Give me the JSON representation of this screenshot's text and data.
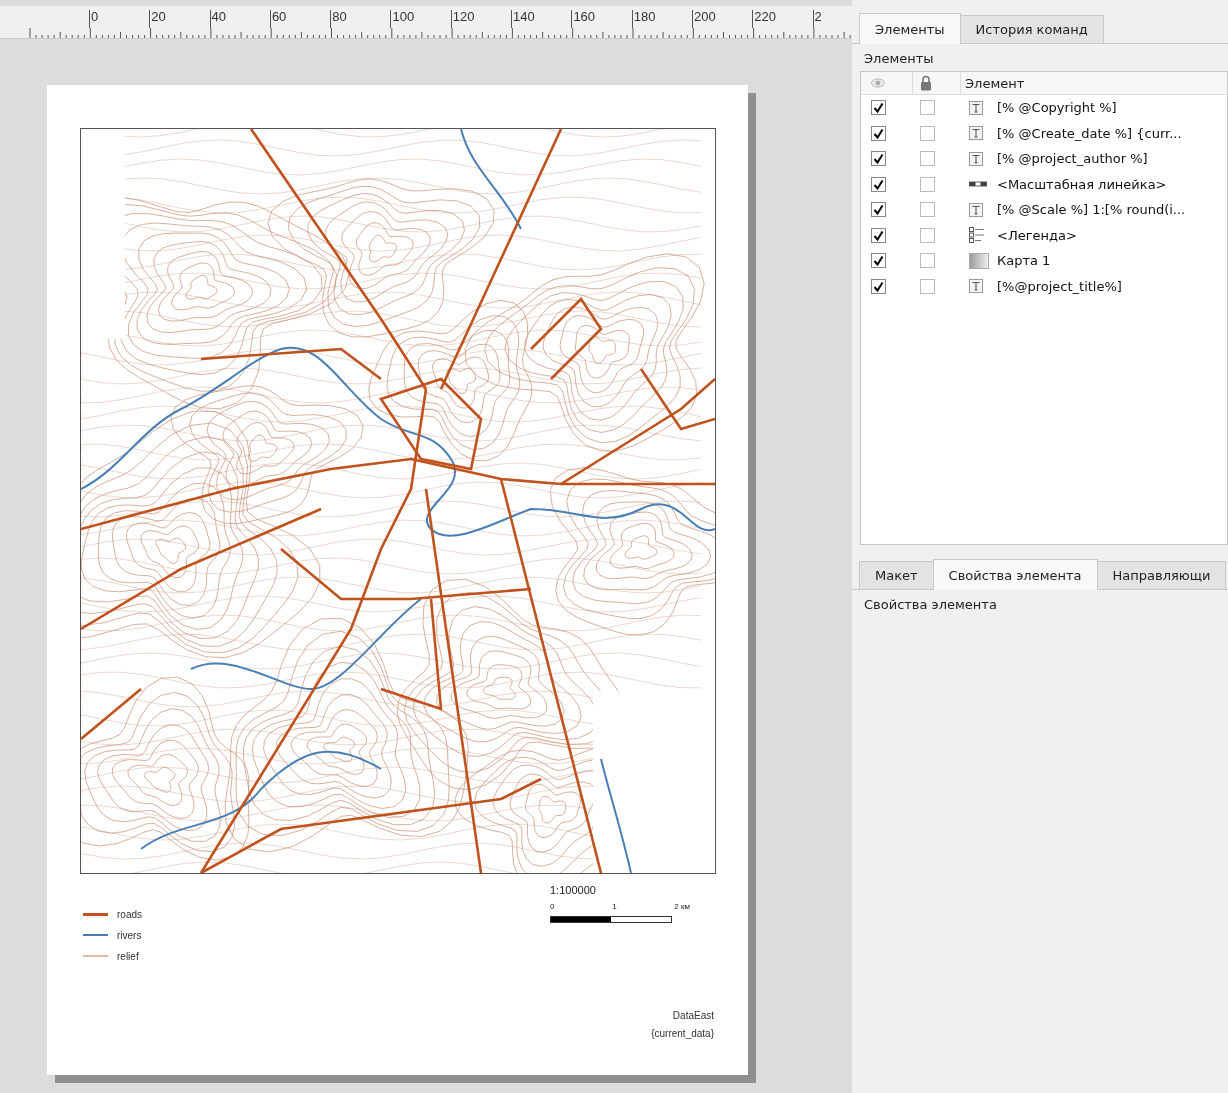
{
  "ruler": {
    "labels": [
      "0",
      "20",
      "40",
      "60",
      "80",
      "100",
      "120",
      "140",
      "160",
      "180",
      "200",
      "220",
      "2"
    ]
  },
  "layout_page": {
    "legend": [
      {
        "label": "roads",
        "color": "#c0521d",
        "kind": "thick"
      },
      {
        "label": "rivers",
        "color": "#4a7fb5",
        "kind": "thin"
      },
      {
        "label": "relief",
        "color": "#e2b9a8",
        "kind": "thin"
      }
    ],
    "scale": {
      "title": "1:100000",
      "labels": [
        "0",
        "1",
        "2 км"
      ]
    },
    "footer": [
      "DataEast",
      "{current_data}"
    ]
  },
  "items_panel": {
    "tabs": [
      {
        "label": "Элементы",
        "selected": true
      },
      {
        "label": "История команд",
        "selected": false
      }
    ],
    "heading": "Элементы",
    "column": "Элемент",
    "rows": [
      {
        "kind": "text",
        "label": "[% @Copyright %]",
        "visible": true,
        "locked": false
      },
      {
        "kind": "text",
        "label": "[% @Create_date %] {curr...",
        "visible": true,
        "locked": false
      },
      {
        "kind": "text",
        "label": "[% @project_author %]",
        "visible": true,
        "locked": false
      },
      {
        "kind": "scalebar",
        "label": "<Масштабная линейка>",
        "visible": true,
        "locked": false
      },
      {
        "kind": "text",
        "label": "[% @Scale %] 1:[% round(i...",
        "visible": true,
        "locked": false
      },
      {
        "kind": "legend",
        "label": "<Легенда>",
        "visible": true,
        "locked": false
      },
      {
        "kind": "map",
        "label": "Карта 1",
        "visible": true,
        "locked": false
      },
      {
        "kind": "text",
        "label": "[%@project_title%]",
        "visible": true,
        "locked": false
      }
    ]
  },
  "properties_panel": {
    "tabs": [
      {
        "label": "Макет",
        "selected": false
      },
      {
        "label": "Свойства элемента",
        "selected": true
      },
      {
        "label": "Направляющи",
        "selected": false
      }
    ],
    "heading": "Свойства элемента"
  }
}
